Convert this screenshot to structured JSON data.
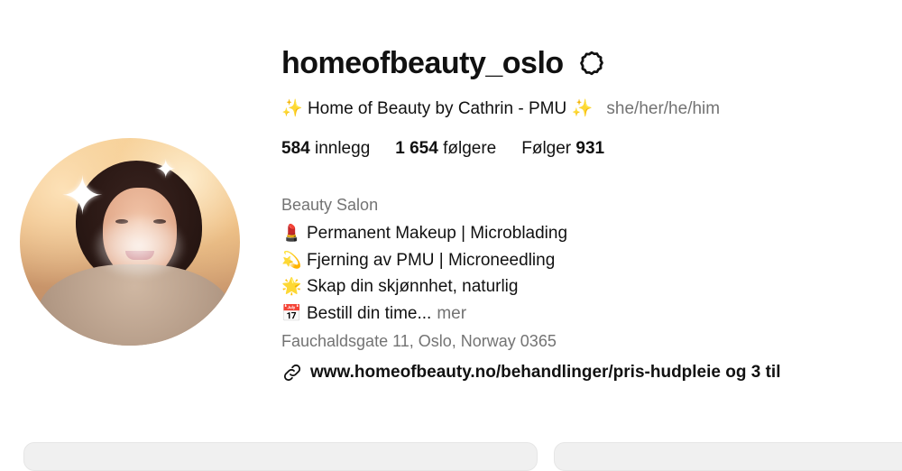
{
  "profile": {
    "username": "homeofbeauty_oslo",
    "full_name": "Home of Beauty by Cathrin - PMU",
    "full_name_prefix_emoji": "✨",
    "full_name_suffix_emoji": "✨",
    "pronouns": "she/her/he/him",
    "stats": {
      "posts_count": "584",
      "posts_label": "innlegg",
      "followers_count": "1 654",
      "followers_label": "følgere",
      "following_label": "Følger",
      "following_count": "931"
    },
    "category": "Beauty Salon",
    "bio": [
      {
        "emoji": "💄",
        "text": "Permanent Makeup | Microblading"
      },
      {
        "emoji": "💫",
        "text": "Fjerning av PMU | Microneedling"
      },
      {
        "emoji": "🌟",
        "text": "Skap din skjønnhet, naturlig"
      },
      {
        "emoji": "📅",
        "text": "Bestill din time..."
      }
    ],
    "more_label": "mer",
    "address": "Fauchaldsgate 11, Oslo, Norway 0365",
    "link": "www.homeofbeauty.no/behandlinger/pris-hudpleie og 3 til"
  },
  "icons": {
    "settings": "gear-icon",
    "link": "link-icon",
    "avatar": "profile-photo"
  },
  "colors": {
    "text": "#111111",
    "secondary": "#737373",
    "accent_sparkle": "#f5b400"
  }
}
